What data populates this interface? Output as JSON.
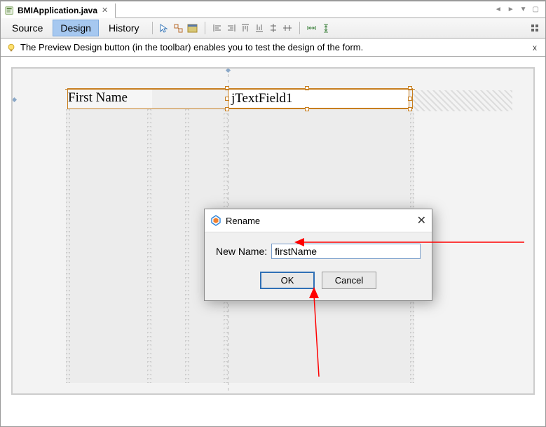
{
  "file_tab": {
    "name": "BMIApplication.java",
    "icon": "java-file-icon"
  },
  "view_tabs": {
    "source": "Source",
    "design": "Design",
    "history": "History",
    "active": "Design"
  },
  "info_bar": {
    "message": "The Preview Design button (in the toolbar) enables you to test the design of the form."
  },
  "canvas": {
    "label_text": "First Name",
    "textfield_value": "jTextField1"
  },
  "rename_dialog": {
    "title": "Rename",
    "new_name_label": "New Name:",
    "input_value": "firstName",
    "ok_label": "OK",
    "cancel_label": "Cancel"
  }
}
